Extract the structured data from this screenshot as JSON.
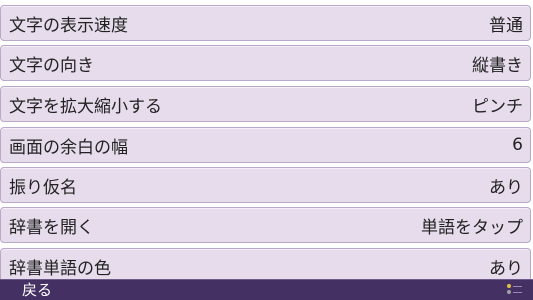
{
  "settings": [
    {
      "label": "文字の表示速度",
      "value": "普通"
    },
    {
      "label": "文字の向き",
      "value": "縦書き"
    },
    {
      "label": "文字を拡大縮小する",
      "value": "ピンチ"
    },
    {
      "label": "画面の余白の幅",
      "value": "6"
    },
    {
      "label": "振り仮名",
      "value": "あり"
    },
    {
      "label": "辞書を開く",
      "value": "単語をタップ"
    },
    {
      "label": "辞書単語の色",
      "value": "あり"
    }
  ],
  "footer": {
    "back_label": "戻る",
    "controls_hint_icon": "button-hint-icon"
  },
  "colors": {
    "row_background": "#e6dcec",
    "row_border": "#b9a8c8",
    "footer_background": "#453063",
    "text": "#222222"
  }
}
